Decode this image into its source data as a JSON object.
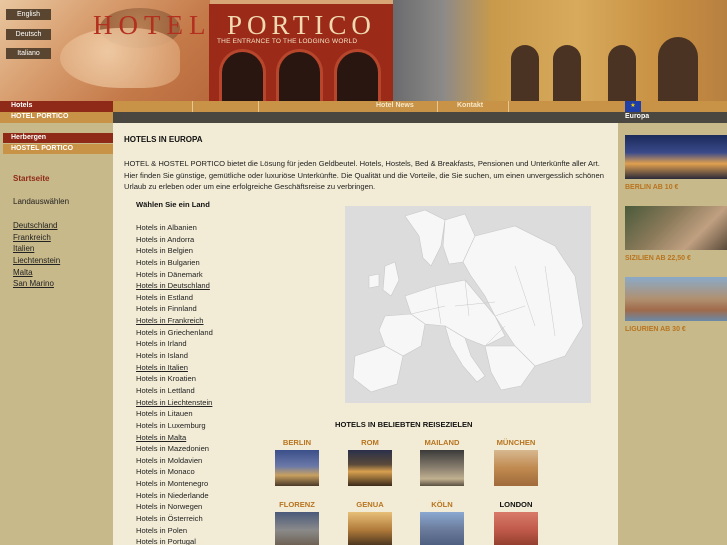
{
  "header": {
    "languages": [
      "English",
      "Deutsch",
      "Italiano"
    ],
    "logo_hotel": "HOTEL",
    "logo_portico": "PORTICO",
    "tagline": "THE ENTRANCE TO THE LODGING WORLD"
  },
  "nav": {
    "hotels": "Hotels",
    "hotel_portico": "HOTEL PORTICO",
    "hotel_news": "Hotel News",
    "kontakt": "Kontakt",
    "europa": "Europa",
    "herbergen": "Herbergen",
    "hostel_portico": "HOSTEL PORTICO"
  },
  "sidebar": {
    "startseite": "Startseite",
    "land_label": "Landauswählen",
    "countries": [
      "Deutschland",
      "Frankreich",
      "Italien",
      "Liechtenstein",
      "Malta",
      "San Marino"
    ]
  },
  "main": {
    "title": "HOTELS IN EUROPA",
    "intro": "HOTEL & HOSTEL PORTICO bietet die Lösung für jeden Geldbeutel. Hotels, Hostels, Bed & Breakfasts, Pensionen und Unterkünfte aller Art. Hier finden Sie günstige, gemütliche oder luxuriöse Unterkünfte. Die Qualität und die Vorteile, die Sie suchen, um einen unvergesslich schönen Urlaub zu erleben oder um eine erfolgreiche Geschäftsreise zu verbringen.",
    "choose_country": "Wählen Sie ein Land",
    "hotel_links": [
      {
        "label": "Hotels in Albanien",
        "linked": false
      },
      {
        "label": "Hotels in Andorra",
        "linked": false
      },
      {
        "label": "Hotels in Belgien",
        "linked": false
      },
      {
        "label": "Hotels in Bulgarien",
        "linked": false
      },
      {
        "label": "Hotels in Dänemark",
        "linked": false
      },
      {
        "label": "Hotels in Deutschland",
        "linked": true
      },
      {
        "label": "Hotels in Estland",
        "linked": false
      },
      {
        "label": "Hotels in Finnland",
        "linked": false
      },
      {
        "label": "Hotels in Frankreich",
        "linked": true
      },
      {
        "label": "Hotels in Griechenland",
        "linked": false
      },
      {
        "label": "Hotels in Irland",
        "linked": false
      },
      {
        "label": "Hotels in Island",
        "linked": false
      },
      {
        "label": "Hotels in Italien",
        "linked": true
      },
      {
        "label": "Hotels in Kroatien",
        "linked": false
      },
      {
        "label": "Hotels in Lettland",
        "linked": false
      },
      {
        "label": "Hotels in Liechtenstein",
        "linked": true
      },
      {
        "label": "Hotels in Litauen",
        "linked": false
      },
      {
        "label": "Hotels in Luxemburg",
        "linked": false
      },
      {
        "label": "Hotels in Malta",
        "linked": true
      },
      {
        "label": "Hotels in Mazedonien",
        "linked": false
      },
      {
        "label": "Hotels in Moldavien",
        "linked": false
      },
      {
        "label": "Hotels in Monaco",
        "linked": false
      },
      {
        "label": "Hotels in Montenegro",
        "linked": false
      },
      {
        "label": "Hotels in Niederlande",
        "linked": false
      },
      {
        "label": "Hotels in Norwegen",
        "linked": false
      },
      {
        "label": "Hotels in Österreich",
        "linked": false
      },
      {
        "label": "Hotels in Polen",
        "linked": false
      },
      {
        "label": "Hotels in Portugal",
        "linked": false
      }
    ],
    "popular_title": "HOTELS IN BELIEBTEN REISEZIELEN",
    "popular_row1": [
      "BERLIN",
      "ROM",
      "MAILAND",
      "MÜNCHEN"
    ],
    "popular_row2": [
      "FLORENZ",
      "GENUA",
      "KÖLN",
      "LONDON"
    ]
  },
  "right": {
    "promos": [
      {
        "caption": "BERLIN AB 10 €"
      },
      {
        "caption": "SIZILIEN AB 22,50 €"
      },
      {
        "caption": "LIGURIEN AB 30 €"
      }
    ]
  },
  "colors": {
    "brand_red": "#9b2a18",
    "accent_gold": "#b8741f",
    "nav_orange": "#c89247",
    "sidebar_bg": "#c8b98a",
    "content_bg": "#f2ecd6"
  }
}
